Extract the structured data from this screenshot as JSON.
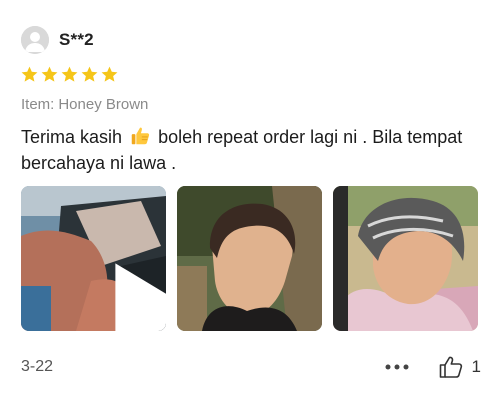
{
  "review": {
    "username": "S**2",
    "rating": 5,
    "max_rating": 5,
    "item_label": "Item:",
    "item_value": "Honey Brown",
    "text_before_emoji": "Terima kasih",
    "emoji_icon": "thumbs-up-emoji",
    "text_after_emoji": "boleh repeat order lagi ni . Bila tempat bercahaya ni lawa .",
    "media": [
      {
        "kind": "video",
        "icon": "play-icon"
      },
      {
        "kind": "photo"
      },
      {
        "kind": "photo"
      }
    ],
    "date": "3-22",
    "more_icon": "more-dots-icon",
    "like_icon": "thumbs-up-outline-icon",
    "like_count": "1"
  },
  "colors": {
    "star": "#f5c518",
    "muted_text": "#8a8a8a",
    "avatar_bg": "#d9d9d9"
  }
}
